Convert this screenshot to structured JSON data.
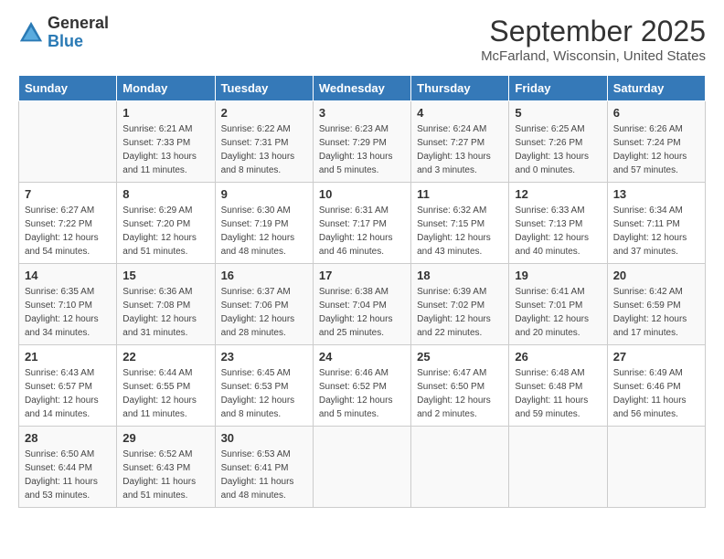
{
  "logo": {
    "general": "General",
    "blue": "Blue"
  },
  "header": {
    "month": "September 2025",
    "location": "McFarland, Wisconsin, United States"
  },
  "weekdays": [
    "Sunday",
    "Monday",
    "Tuesday",
    "Wednesday",
    "Thursday",
    "Friday",
    "Saturday"
  ],
  "weeks": [
    [
      {
        "day": "",
        "sunrise": "",
        "sunset": "",
        "daylight": ""
      },
      {
        "day": "1",
        "sunrise": "Sunrise: 6:21 AM",
        "sunset": "Sunset: 7:33 PM",
        "daylight": "Daylight: 13 hours and 11 minutes."
      },
      {
        "day": "2",
        "sunrise": "Sunrise: 6:22 AM",
        "sunset": "Sunset: 7:31 PM",
        "daylight": "Daylight: 13 hours and 8 minutes."
      },
      {
        "day": "3",
        "sunrise": "Sunrise: 6:23 AM",
        "sunset": "Sunset: 7:29 PM",
        "daylight": "Daylight: 13 hours and 5 minutes."
      },
      {
        "day": "4",
        "sunrise": "Sunrise: 6:24 AM",
        "sunset": "Sunset: 7:27 PM",
        "daylight": "Daylight: 13 hours and 3 minutes."
      },
      {
        "day": "5",
        "sunrise": "Sunrise: 6:25 AM",
        "sunset": "Sunset: 7:26 PM",
        "daylight": "Daylight: 13 hours and 0 minutes."
      },
      {
        "day": "6",
        "sunrise": "Sunrise: 6:26 AM",
        "sunset": "Sunset: 7:24 PM",
        "daylight": "Daylight: 12 hours and 57 minutes."
      }
    ],
    [
      {
        "day": "7",
        "sunrise": "Sunrise: 6:27 AM",
        "sunset": "Sunset: 7:22 PM",
        "daylight": "Daylight: 12 hours and 54 minutes."
      },
      {
        "day": "8",
        "sunrise": "Sunrise: 6:29 AM",
        "sunset": "Sunset: 7:20 PM",
        "daylight": "Daylight: 12 hours and 51 minutes."
      },
      {
        "day": "9",
        "sunrise": "Sunrise: 6:30 AM",
        "sunset": "Sunset: 7:19 PM",
        "daylight": "Daylight: 12 hours and 48 minutes."
      },
      {
        "day": "10",
        "sunrise": "Sunrise: 6:31 AM",
        "sunset": "Sunset: 7:17 PM",
        "daylight": "Daylight: 12 hours and 46 minutes."
      },
      {
        "day": "11",
        "sunrise": "Sunrise: 6:32 AM",
        "sunset": "Sunset: 7:15 PM",
        "daylight": "Daylight: 12 hours and 43 minutes."
      },
      {
        "day": "12",
        "sunrise": "Sunrise: 6:33 AM",
        "sunset": "Sunset: 7:13 PM",
        "daylight": "Daylight: 12 hours and 40 minutes."
      },
      {
        "day": "13",
        "sunrise": "Sunrise: 6:34 AM",
        "sunset": "Sunset: 7:11 PM",
        "daylight": "Daylight: 12 hours and 37 minutes."
      }
    ],
    [
      {
        "day": "14",
        "sunrise": "Sunrise: 6:35 AM",
        "sunset": "Sunset: 7:10 PM",
        "daylight": "Daylight: 12 hours and 34 minutes."
      },
      {
        "day": "15",
        "sunrise": "Sunrise: 6:36 AM",
        "sunset": "Sunset: 7:08 PM",
        "daylight": "Daylight: 12 hours and 31 minutes."
      },
      {
        "day": "16",
        "sunrise": "Sunrise: 6:37 AM",
        "sunset": "Sunset: 7:06 PM",
        "daylight": "Daylight: 12 hours and 28 minutes."
      },
      {
        "day": "17",
        "sunrise": "Sunrise: 6:38 AM",
        "sunset": "Sunset: 7:04 PM",
        "daylight": "Daylight: 12 hours and 25 minutes."
      },
      {
        "day": "18",
        "sunrise": "Sunrise: 6:39 AM",
        "sunset": "Sunset: 7:02 PM",
        "daylight": "Daylight: 12 hours and 22 minutes."
      },
      {
        "day": "19",
        "sunrise": "Sunrise: 6:41 AM",
        "sunset": "Sunset: 7:01 PM",
        "daylight": "Daylight: 12 hours and 20 minutes."
      },
      {
        "day": "20",
        "sunrise": "Sunrise: 6:42 AM",
        "sunset": "Sunset: 6:59 PM",
        "daylight": "Daylight: 12 hours and 17 minutes."
      }
    ],
    [
      {
        "day": "21",
        "sunrise": "Sunrise: 6:43 AM",
        "sunset": "Sunset: 6:57 PM",
        "daylight": "Daylight: 12 hours and 14 minutes."
      },
      {
        "day": "22",
        "sunrise": "Sunrise: 6:44 AM",
        "sunset": "Sunset: 6:55 PM",
        "daylight": "Daylight: 12 hours and 11 minutes."
      },
      {
        "day": "23",
        "sunrise": "Sunrise: 6:45 AM",
        "sunset": "Sunset: 6:53 PM",
        "daylight": "Daylight: 12 hours and 8 minutes."
      },
      {
        "day": "24",
        "sunrise": "Sunrise: 6:46 AM",
        "sunset": "Sunset: 6:52 PM",
        "daylight": "Daylight: 12 hours and 5 minutes."
      },
      {
        "day": "25",
        "sunrise": "Sunrise: 6:47 AM",
        "sunset": "Sunset: 6:50 PM",
        "daylight": "Daylight: 12 hours and 2 minutes."
      },
      {
        "day": "26",
        "sunrise": "Sunrise: 6:48 AM",
        "sunset": "Sunset: 6:48 PM",
        "daylight": "Daylight: 11 hours and 59 minutes."
      },
      {
        "day": "27",
        "sunrise": "Sunrise: 6:49 AM",
        "sunset": "Sunset: 6:46 PM",
        "daylight": "Daylight: 11 hours and 56 minutes."
      }
    ],
    [
      {
        "day": "28",
        "sunrise": "Sunrise: 6:50 AM",
        "sunset": "Sunset: 6:44 PM",
        "daylight": "Daylight: 11 hours and 53 minutes."
      },
      {
        "day": "29",
        "sunrise": "Sunrise: 6:52 AM",
        "sunset": "Sunset: 6:43 PM",
        "daylight": "Daylight: 11 hours and 51 minutes."
      },
      {
        "day": "30",
        "sunrise": "Sunrise: 6:53 AM",
        "sunset": "Sunset: 6:41 PM",
        "daylight": "Daylight: 11 hours and 48 minutes."
      },
      {
        "day": "",
        "sunrise": "",
        "sunset": "",
        "daylight": ""
      },
      {
        "day": "",
        "sunrise": "",
        "sunset": "",
        "daylight": ""
      },
      {
        "day": "",
        "sunrise": "",
        "sunset": "",
        "daylight": ""
      },
      {
        "day": "",
        "sunrise": "",
        "sunset": "",
        "daylight": ""
      }
    ]
  ]
}
